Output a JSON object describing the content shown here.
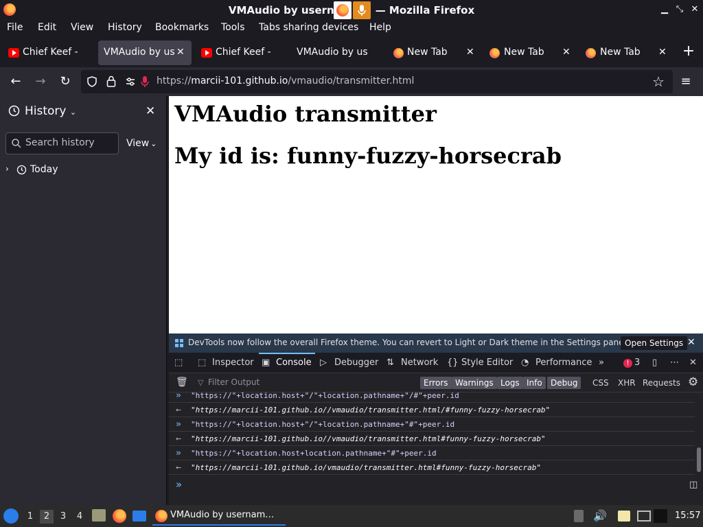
{
  "window": {
    "title": "VMAudio by username — Mozilla Firefox",
    "title_visible_left": "VMAudio by usern",
    "title_visible_right": "— Mozilla Firefox"
  },
  "menubar": {
    "items": [
      "File",
      "Edit",
      "View",
      "History",
      "Bookmarks",
      "Tools",
      "Tabs sharing devices",
      "Help"
    ]
  },
  "tabs": [
    {
      "label": "Chief Keef - Y",
      "icon": "youtube-icon",
      "selected": false
    },
    {
      "label": "VMAudio by use",
      "icon": "none",
      "selected": true
    },
    {
      "label": "Chief Keef - Y",
      "icon": "youtube-icon",
      "selected": false
    },
    {
      "label": "VMAudio by use",
      "icon": "none",
      "selected": false
    },
    {
      "label": "New Tab",
      "icon": "firefox-icon",
      "selected": false
    },
    {
      "label": "New Tab",
      "icon": "firefox-icon",
      "selected": false
    },
    {
      "label": "New Tab",
      "icon": "firefox-icon",
      "selected": false
    }
  ],
  "urlbar": {
    "url_prefix": "https://",
    "url_host": "marcii-101.github.io",
    "url_path": "/vmaudio/transmitter.html"
  },
  "sidebar": {
    "title": "History",
    "search_placeholder": "Search history",
    "view_label": "View",
    "groups": [
      "Today"
    ]
  },
  "page": {
    "heading": "VMAudio transmitter",
    "id_line": "My id is: funny-fuzzy-horsecrab"
  },
  "devtools": {
    "notice": "DevTools now follow the overall Firefox theme. You can revert to Light or Dark theme in the Settings panel.",
    "notice_button": "Open Settings",
    "tabs": [
      "Inspector",
      "Console",
      "Debugger",
      "Network",
      "Style Editor",
      "Performance"
    ],
    "active_tab": "Console",
    "error_count": "3",
    "filter_placeholder": "Filter Output",
    "filter_buttons": [
      "Errors",
      "Warnings",
      "Logs",
      "Info",
      "Debug"
    ],
    "filter_extra": [
      "CSS",
      "XHR",
      "Requests"
    ],
    "console": [
      {
        "type": "input",
        "text": "\"https://\"+location.host+\"/\"+location.pathname+\"/#\"+peer.id"
      },
      {
        "type": "result",
        "text": "\"https://marcii-101.github.io//vmaudio/transmitter.html/#funny-fuzzy-horsecrab\""
      },
      {
        "type": "input",
        "text": "\"https://\"+location.host+\"/\"+location.pathname+\"#\"+peer.id"
      },
      {
        "type": "result",
        "text": "\"https://marcii-101.github.io//vmaudio/transmitter.html#funny-fuzzy-horsecrab\""
      },
      {
        "type": "input",
        "text": "\"https://\"+location.host+location.pathname+\"#\"+peer.id"
      },
      {
        "type": "result",
        "text": "\"https://marcii-101.github.io/vmaudio/transmitter.html#funny-fuzzy-horsecrab\""
      }
    ]
  },
  "taskbar": {
    "workspaces": [
      "1",
      "2",
      "3",
      "4"
    ],
    "current_workspace": "2",
    "task_label": "VMAudio by usernam…",
    "clock": "15:57"
  }
}
